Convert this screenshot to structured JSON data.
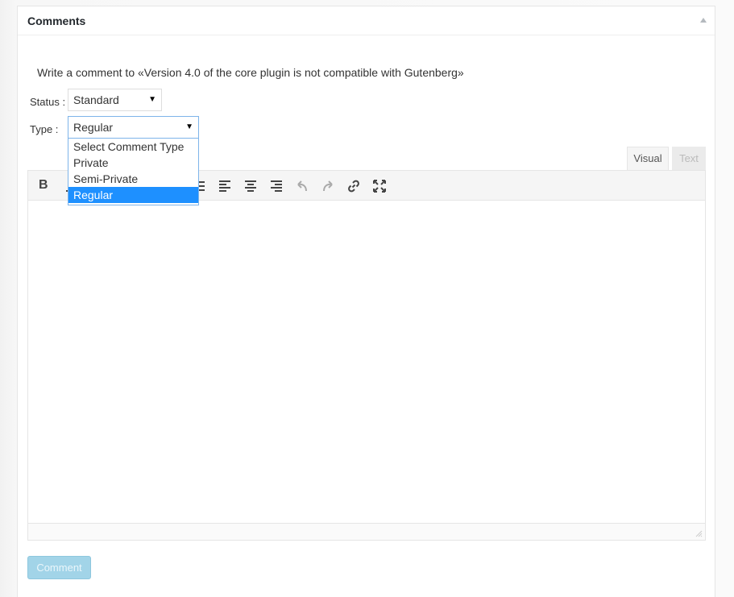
{
  "panel": {
    "title": "Comments"
  },
  "intro": "Write a comment to «Version 4.0 of the core plugin is not compatible with Gutenberg»",
  "status": {
    "label": "Status :",
    "value": "Standard"
  },
  "type": {
    "label": "Type :",
    "value": "Regular",
    "options": [
      "Select Comment Type",
      "Private",
      "Semi-Private",
      "Regular"
    ],
    "selected_index": 3
  },
  "editor": {
    "tabs": {
      "visual": "Visual",
      "text": "Text"
    },
    "active_tab": "Visual",
    "bold_label": "B",
    "toolbar_icons": [
      "bold-icon",
      "italic-icon",
      "bullet-list-icon",
      "numbered-list-icon",
      "blockquote-icon",
      "align-left-icon",
      "align-center-icon",
      "align-right-icon",
      "undo-icon",
      "redo-icon",
      "link-icon",
      "fullscreen-icon"
    ]
  },
  "submit_label": "Comment",
  "colors": {
    "selected_option": "#1e90ff",
    "button": "#a2d4e8"
  }
}
